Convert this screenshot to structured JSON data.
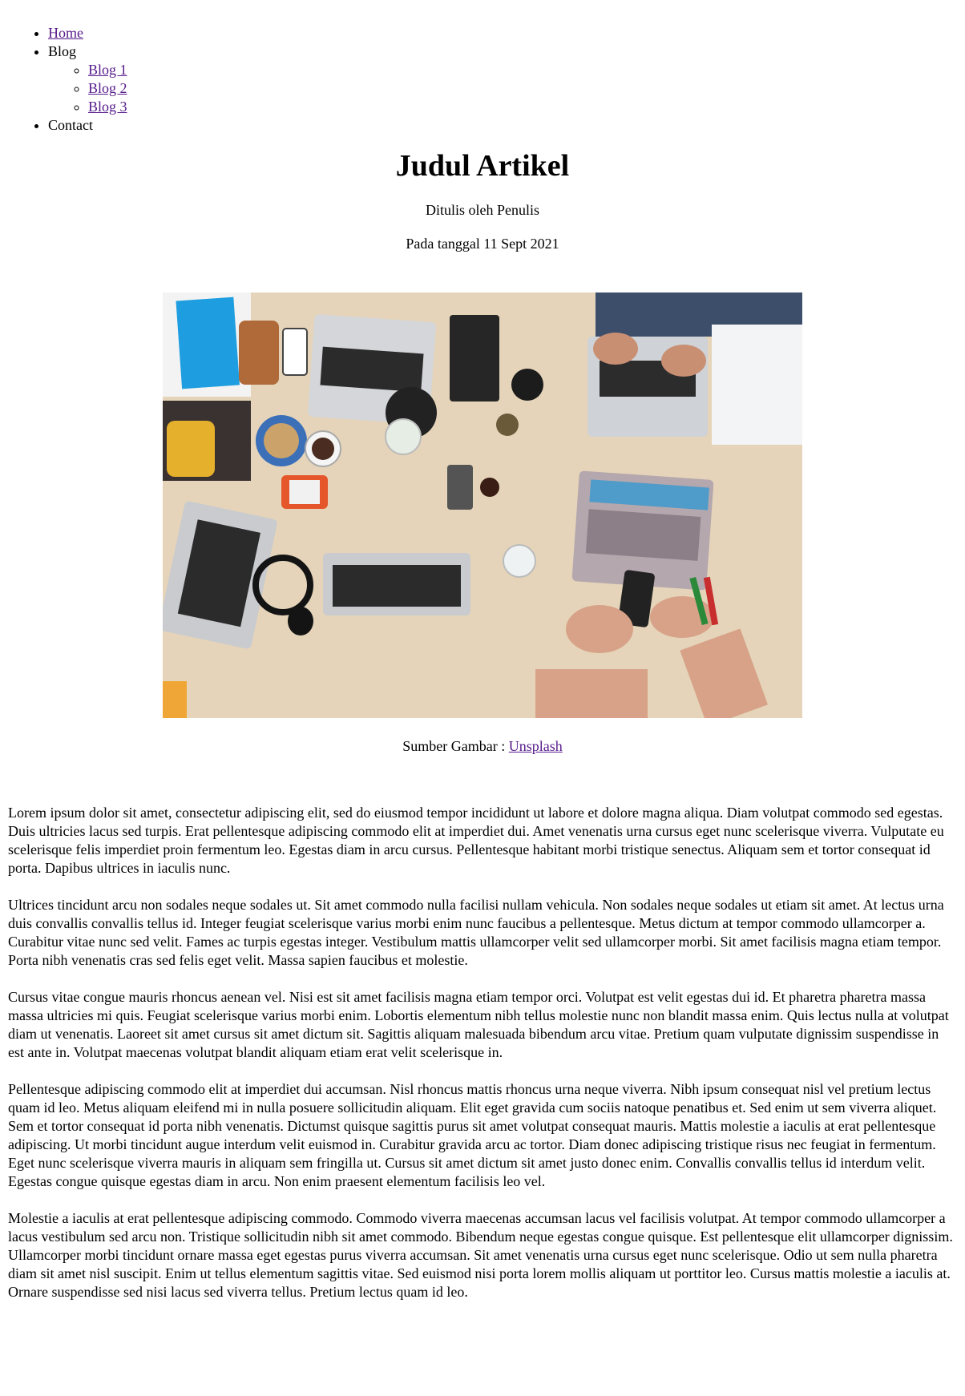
{
  "nav": {
    "home": "Home",
    "blog": "Blog",
    "blog_items": [
      "Blog 1",
      "Blog 2",
      "Blog 3"
    ],
    "contact": "Contact"
  },
  "article": {
    "title": "Judul Artikel",
    "author": "Ditulis oleh Penulis",
    "date": "Pada tanggal 11 Sept 2021",
    "image_caption_prefix": "Sumber Gambar : ",
    "image_caption_link": "Unsplash",
    "paragraphs": [
      "Lorem ipsum dolor sit amet, consectetur adipiscing elit, sed do eiusmod tempor incididunt ut labore et dolore magna aliqua. Diam volutpat commodo sed egestas. Duis ultricies lacus sed turpis. Erat pellentesque adipiscing commodo elit at imperdiet dui. Amet venenatis urna cursus eget nunc scelerisque viverra. Vulputate eu scelerisque felis imperdiet proin fermentum leo. Egestas diam in arcu cursus. Pellentesque habitant morbi tristique senectus. Aliquam sem et tortor consequat id porta. Dapibus ultrices in iaculis nunc.",
      "Ultrices tincidunt arcu non sodales neque sodales ut. Sit amet commodo nulla facilisi nullam vehicula. Non sodales neque sodales ut etiam sit amet. At lectus urna duis convallis convallis tellus id. Integer feugiat scelerisque varius morbi enim nunc faucibus a pellentesque. Metus dictum at tempor commodo ullamcorper a. Curabitur vitae nunc sed velit. Fames ac turpis egestas integer. Vestibulum mattis ullamcorper velit sed ullamcorper morbi. Sit amet facilisis magna etiam tempor. Porta nibh venenatis cras sed felis eget velit. Massa sapien faucibus et molestie.",
      "Cursus vitae congue mauris rhoncus aenean vel. Nisi est sit amet facilisis magna etiam tempor orci. Volutpat est velit egestas dui id. Et pharetra pharetra massa massa ultricies mi quis. Feugiat scelerisque varius morbi enim. Lobortis elementum nibh tellus molestie nunc non blandit massa enim. Quis lectus nulla at volutpat diam ut venenatis. Laoreet sit amet cursus sit amet dictum sit. Sagittis aliquam malesuada bibendum arcu vitae. Pretium quam vulputate dignissim suspendisse in est ante in. Volutpat maecenas volutpat blandit aliquam etiam erat velit scelerisque in.",
      "Pellentesque adipiscing commodo elit at imperdiet dui accumsan. Nisl rhoncus mattis rhoncus urna neque viverra. Nibh ipsum consequat nisl vel pretium lectus quam id leo. Metus aliquam eleifend mi in nulla posuere sollicitudin aliquam. Elit eget gravida cum sociis natoque penatibus et. Sed enim ut sem viverra aliquet. Sem et tortor consequat id porta nibh venenatis. Dictumst quisque sagittis purus sit amet volutpat consequat mauris. Mattis molestie a iaculis at erat pellentesque adipiscing. Ut morbi tincidunt augue interdum velit euismod in. Curabitur gravida arcu ac tortor. Diam donec adipiscing tristique risus nec feugiat in fermentum. Eget nunc scelerisque viverra mauris in aliquam sem fringilla ut. Cursus sit amet dictum sit amet justo donec enim. Convallis convallis tellus id interdum velit. Egestas congue quisque egestas diam in arcu. Non enim praesent elementum facilisis leo vel.",
      "Molestie a iaculis at erat pellentesque adipiscing commodo. Commodo viverra maecenas accumsan lacus vel facilisis volutpat. At tempor commodo ullamcorper a lacus vestibulum sed arcu non. Tristique sollicitudin nibh sit amet commodo. Bibendum neque egestas congue quisque. Est pellentesque elit ullamcorper dignissim. Ullamcorper morbi tincidunt ornare massa eget egestas purus viverra accumsan. Sit amet venenatis urna cursus eget nunc scelerisque. Odio ut sem nulla pharetra diam sit amet nisl suscipit. Enim ut tellus elementum sagittis vitae. Sed euismod nisi porta lorem mollis aliquam ut porttitor leo. Cursus mattis molestie a iaculis at. Ornare suspendisse sed nisi lacus sed viverra tellus. Pretium lectus quam id leo."
    ]
  },
  "colors": {
    "link": "#2a00cc",
    "link_visited": "#551a8b",
    "table_wood": "#e8d6bd"
  }
}
